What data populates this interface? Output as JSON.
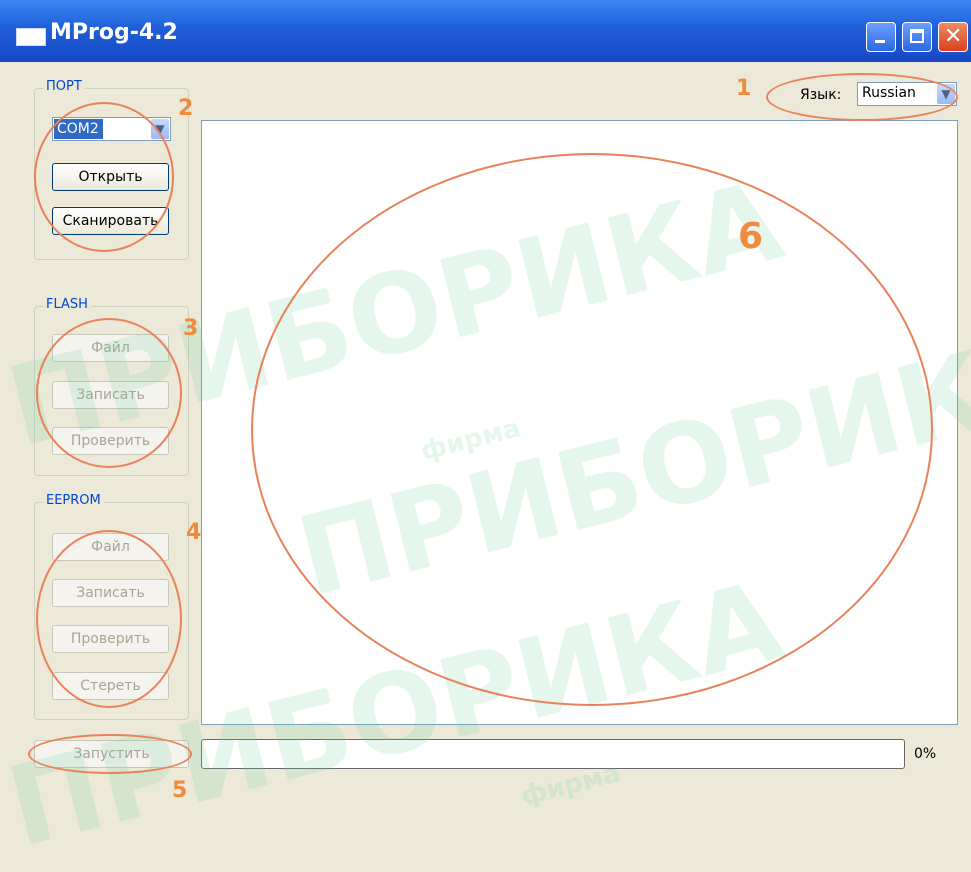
{
  "window": {
    "title": "MProg-4.2"
  },
  "language": {
    "label": "Язык:",
    "value": "Russian"
  },
  "port": {
    "group_title": "ПОРТ",
    "selected": "COM2",
    "open_label": "Открыть",
    "scan_label": "Сканировать"
  },
  "flash": {
    "group_title": "FLASH",
    "file_label": "Файл",
    "write_label": "Записать",
    "verify_label": "Проверить"
  },
  "eeprom": {
    "group_title": "EEPROM",
    "file_label": "Файл",
    "write_label": "Записать",
    "verify_label": "Проверить",
    "erase_label": "Стереть"
  },
  "run_label": "Запустить",
  "progress": {
    "value": 0,
    "text": "0%"
  },
  "annotations": [
    "1",
    "2",
    "3",
    "4",
    "5",
    "6"
  ],
  "watermark": {
    "brand": "ПРИБОРИКА",
    "sub": "фирма"
  },
  "colors": {
    "annotation": "#e8825a",
    "titlebar": "#1f5fd8",
    "group_title": "#0046d5"
  }
}
